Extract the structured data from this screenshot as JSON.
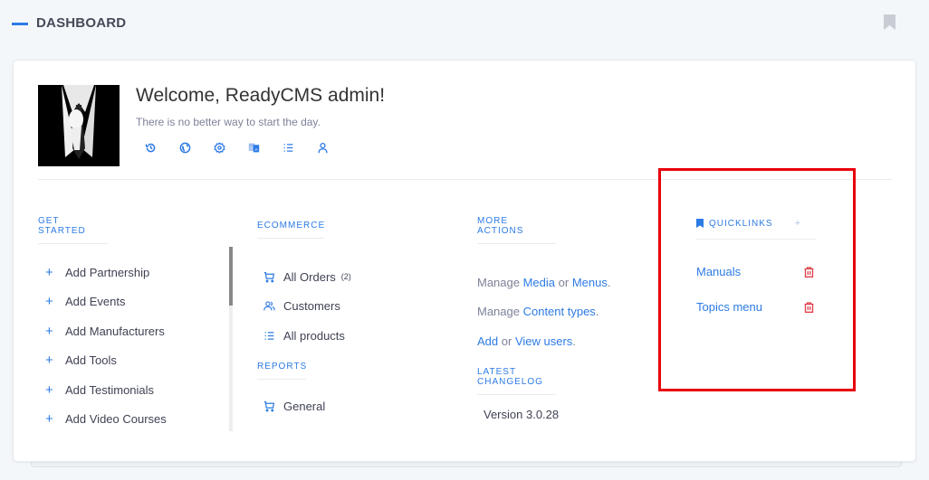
{
  "header": {
    "title": "DASHBOARD",
    "bookmark_icon": "bookmark-icon"
  },
  "welcome": {
    "title": "Welcome, ReadyCMS admin!",
    "subtitle": "There is no better way to start the day.",
    "icons": [
      "history-icon",
      "globe-icon",
      "settings-icon",
      "translate-icon",
      "list-icon",
      "user-icon"
    ]
  },
  "get_started": {
    "title": "GET STARTED",
    "items": [
      {
        "label": "Add Partnership"
      },
      {
        "label": "Add Events"
      },
      {
        "label": "Add Manufacturers"
      },
      {
        "label": "Add Tools"
      },
      {
        "label": "Add Testimonials"
      },
      {
        "label": "Add Video Courses"
      }
    ]
  },
  "ecommerce": {
    "title": "ECOMMERCE",
    "items": [
      {
        "label": "All Orders",
        "count": "(2)",
        "icon": "cart-icon"
      },
      {
        "label": "Customers",
        "icon": "users-icon"
      },
      {
        "label": "All products",
        "icon": "list-icon"
      }
    ]
  },
  "reports": {
    "title": "REPORTS",
    "items": [
      {
        "label": "General",
        "icon": "cart-icon"
      }
    ]
  },
  "more_actions": {
    "title": "MORE ACTIONS",
    "line1": {
      "prefix": "Manage ",
      "link1": "Media",
      "mid": " or ",
      "link2": "Menus",
      "suffix": "."
    },
    "line2": {
      "prefix": "Manage ",
      "link1": "Content types",
      "suffix": "."
    },
    "line3": {
      "link1": "Add",
      "mid": " or ",
      "link2": "View users",
      "suffix": "."
    }
  },
  "changelog": {
    "title": "LATEST CHANGELOG",
    "version": "Version 3.0.28"
  },
  "quicklinks": {
    "title": "QUICKLINKS",
    "add_label": "+",
    "items": [
      {
        "label": "Manuals"
      },
      {
        "label": "Topics menu"
      }
    ]
  },
  "colors": {
    "accent": "#2d7be5",
    "delete": "#e0404a",
    "annotation": "#e8000b"
  }
}
